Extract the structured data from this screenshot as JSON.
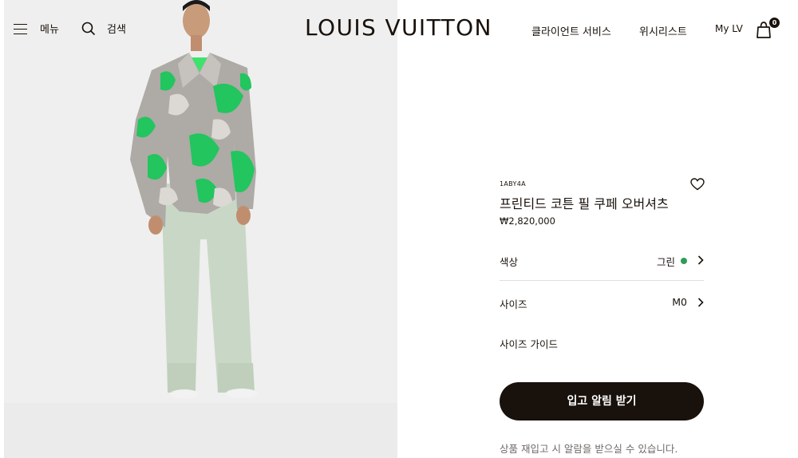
{
  "header": {
    "menu_label": "메뉴",
    "search_label": "검색",
    "logo": "LOUIS VUITTON",
    "nav": {
      "client_service": "클라이언트 서비스",
      "wishlist": "위시리스트",
      "my_lv": "My LV"
    },
    "bag_count": "0"
  },
  "product": {
    "sku": "1ABY4A",
    "title": "프린티드 코튼 필 쿠페 오버셔츠",
    "price": "₩2,820,000",
    "color_label": "색상",
    "color_value": "그린",
    "color_swatch": "#2d9d57",
    "size_label": "사이즈",
    "size_value": "M0",
    "size_guide": "사이즈 가이드",
    "cta": "입고 알림 받기",
    "cta_note": "상품 재입고 시 알람을 받으실 수 있습니다."
  },
  "icons": {
    "menu": "menu-icon",
    "search": "search-icon",
    "bag": "shopping-bag-icon",
    "wishlist": "heart-icon",
    "chevron": "chevron-right-icon"
  }
}
